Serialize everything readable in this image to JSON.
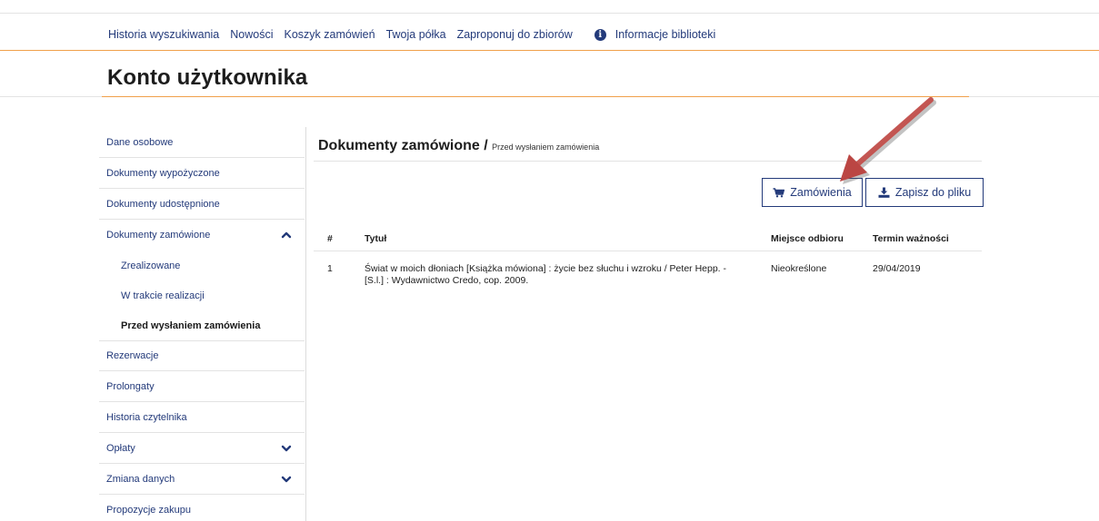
{
  "topnav": {
    "links": [
      "Historia wyszukiwania",
      "Nowości",
      "Koszyk zamówień",
      "Twoja półka",
      "Zaproponuj do zbiorów"
    ],
    "info_label": "Informacje biblioteki",
    "info_glyph": "i"
  },
  "page": {
    "title": "Konto użytkownika"
  },
  "sidebar": {
    "items": [
      "Dane osobowe",
      "Dokumenty wypożyczone",
      "Dokumenty udostępnione",
      "Dokumenty zamówione",
      "Rezerwacje",
      "Prolongaty",
      "Historia czytelnika",
      "Opłaty",
      "Zmiana danych",
      "Propozycje zakupu"
    ],
    "subitems": [
      "Zrealizowane",
      "W trakcie realizacji",
      "Przed wysłaniem zamówienia"
    ]
  },
  "main": {
    "heading": "Dokumenty zamówione /",
    "subheading": "Przed wysłaniem zamówienia",
    "buttons": {
      "orders": "Zamówienia",
      "save": "Zapisz do pliku"
    },
    "table": {
      "headers": [
        "#",
        "Tytuł",
        "Miejsce odbioru",
        "Termin ważności"
      ],
      "rows": [
        {
          "num": "1",
          "title_line1": "Świat w moich dłoniach [Książka mówiona] : życie bez słuchu i wzroku / Peter Hepp. -",
          "title_line2": "[S.l.] : Wydawnictwo Credo, cop. 2009.",
          "pickup": "Nieokreślone",
          "expiry": "29/04/2019"
        }
      ]
    }
  },
  "icons": {
    "info": "info-circle-icon",
    "cart": "shopping-cart-icon",
    "download": "download-icon",
    "chevron_up": "chevron-up-icon",
    "chevron_down": "chevron-down-icon",
    "arrow": "annotation-arrow-icon"
  },
  "colors": {
    "link": "#233a7a",
    "accent": "#f0a04b",
    "arrow": "#c0504d"
  }
}
